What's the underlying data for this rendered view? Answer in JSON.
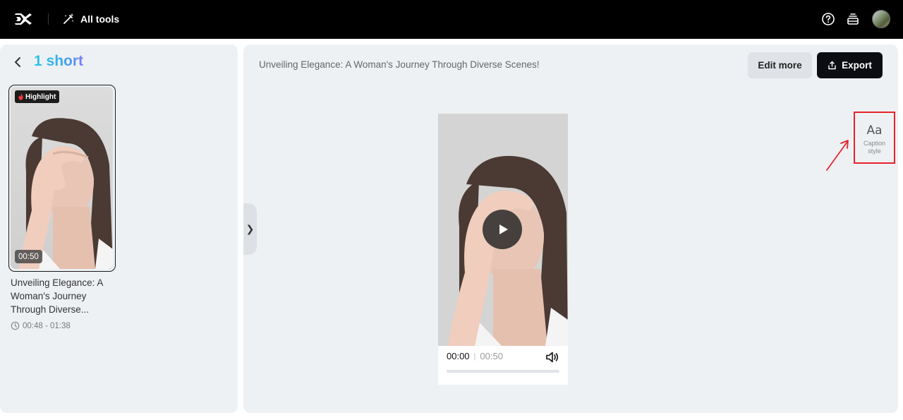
{
  "topbar": {
    "all_tools_label": "All tools",
    "icons": [
      "capcut-logo-icon",
      "magic-wand-icon",
      "help-icon",
      "stack-icon",
      "avatar"
    ]
  },
  "left_panel": {
    "title": "1 short",
    "clip": {
      "badge": "Highlight",
      "duration": "00:50",
      "caption": "Unveiling Elegance: A Woman's Journey Through Diverse...",
      "time_range": "00:48 - 01:38"
    }
  },
  "main": {
    "video_title": "Unveiling Elegance: A Woman's Journey Through Diverse Scenes!",
    "edit_more_label": "Edit more",
    "export_label": "Export",
    "player": {
      "current_time": "00:00",
      "separator": "|",
      "total_time": "00:50",
      "progress": 0
    },
    "caption_style": {
      "icon": "Aa",
      "label": "Caption style"
    }
  },
  "colors": {
    "topbar_bg": "#000000",
    "panel_bg": "#eef1f4",
    "title_gradient_start": "#27c6e8",
    "title_gradient_end": "#7a7cf6",
    "annotation_red": "#e5232a",
    "export_bg": "#0b0d12"
  }
}
